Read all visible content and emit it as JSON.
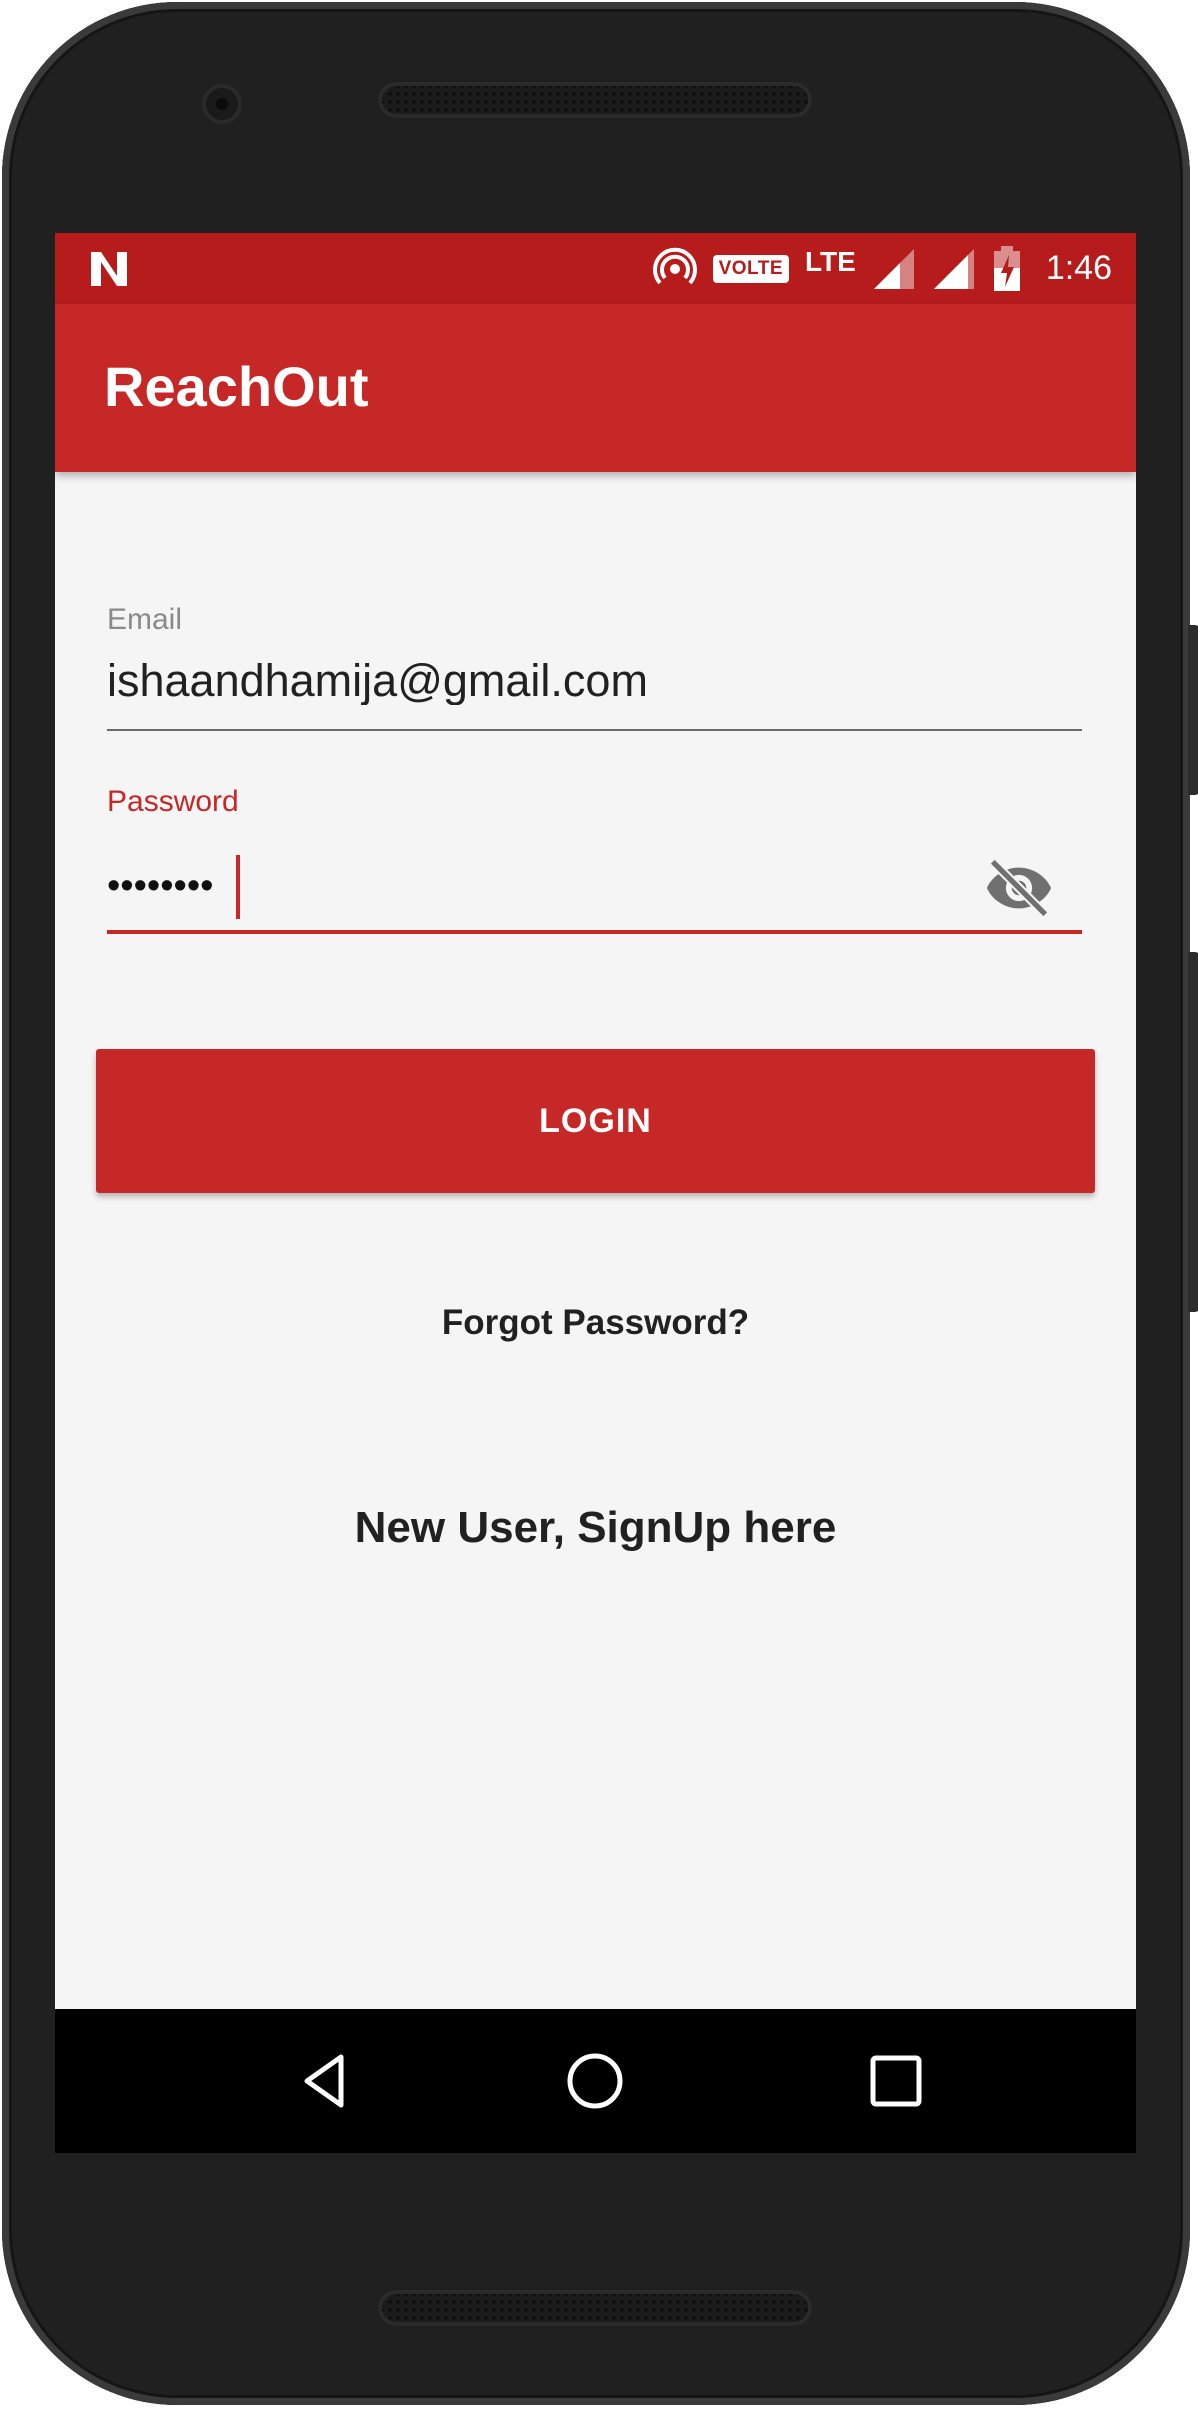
{
  "status_bar": {
    "notification_icon": "n-icon",
    "hotspot_icon": "hotspot-icon",
    "volte_badge": "VOLTE",
    "network_type": "LTE",
    "signal_icons": [
      "signal-icon",
      "signal-icon"
    ],
    "battery_icon": "battery-charging-icon",
    "time": "1:46"
  },
  "app_bar": {
    "title": "ReachOut"
  },
  "form": {
    "email_label": "Email",
    "email_value": "ishaandhamija@gmail.com",
    "password_label": "Password",
    "password_masked": "••••••••",
    "visibility_icon": "eye-off-icon"
  },
  "actions": {
    "login_label": "LOGIN",
    "forgot_password": "Forgot Password?",
    "signup": "New User, SignUp here"
  },
  "nav_bar": {
    "back_icon": "back-icon",
    "home_icon": "home-icon",
    "recents_icon": "recents-icon"
  },
  "colors": {
    "primary": "#c62828",
    "primary_dark": "#b71c1c",
    "background": "#f5f5f5",
    "text": "#212121",
    "hint": "#8a8a8a"
  }
}
